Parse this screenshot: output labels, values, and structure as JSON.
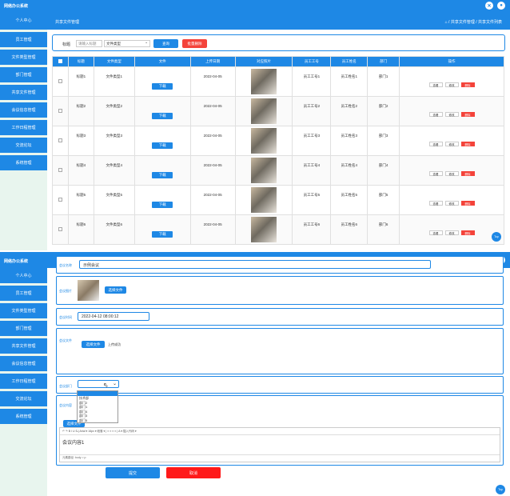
{
  "app_title": "网络办公系统",
  "sidebar_top": [
    "个人中心",
    "员工管理",
    "文件类型管理",
    "部门管理",
    "共享文件管理",
    "会议信息管理",
    "工作日程管理",
    "交流论坛",
    "系统管理"
  ],
  "sidebar_bottom": [
    "个人中心",
    "员工管理",
    "文件类型管理",
    "部门管理",
    "共享文件管理",
    "会议信息管理",
    "工作日程管理",
    "交流论坛",
    "系统管理"
  ],
  "page_header": {
    "title": "共享文件管理",
    "breadcrumb": "⌂ / 共享文件管理 / 共享文件列表"
  },
  "filter": {
    "label": "标题",
    "placeholder": "请输入标题",
    "select_value": "文件类型",
    "search_button": "查询",
    "batch_delete_button": "批量删除"
  },
  "table": {
    "headers": [
      "",
      "标题",
      "文件类型",
      "文件",
      "上传日期",
      "对应照片",
      "员工工号",
      "员工姓名",
      "部门",
      "操作"
    ],
    "download_label": "下载",
    "actions": {
      "view": "查看",
      "edit": "修改",
      "delete": "删除"
    },
    "rows": [
      {
        "title": "标题1",
        "type": "文件类型1",
        "date": "2022-04-05",
        "emp_no": "员工工号1",
        "emp_name": "员工姓名1",
        "dept": "部门1"
      },
      {
        "title": "标题2",
        "type": "文件类型2",
        "date": "2022-04-05",
        "emp_no": "员工工号2",
        "emp_name": "员工姓名2",
        "dept": "部门2"
      },
      {
        "title": "标题3",
        "type": "文件类型3",
        "date": "2022-04-05",
        "emp_no": "员工工号3",
        "emp_name": "员工姓名3",
        "dept": "部门3"
      },
      {
        "title": "标题4",
        "type": "文件类型4",
        "date": "2022-04-05",
        "emp_no": "员工工号4",
        "emp_name": "员工姓名4",
        "dept": "部门4"
      },
      {
        "title": "标题5",
        "type": "文件类型5",
        "date": "2022-04-05",
        "emp_no": "员工工号5",
        "emp_name": "员工姓名5",
        "dept": "部门5"
      },
      {
        "title": "标题6",
        "type": "文件类型6",
        "date": "2022-04-05",
        "emp_no": "员工工号6",
        "emp_name": "员工姓名6",
        "dept": "部门6"
      }
    ]
  },
  "top_button": "Top",
  "form": {
    "name_label": "会议名称",
    "name_value": "示例会议",
    "photo_label": "会议图片",
    "photo_button": "选择文件",
    "time_label": "会议时间",
    "time_value": "2022-04-12 08:00:12",
    "file_label": "会议文件",
    "file_button": "选择文件",
    "file_status": "上传成功",
    "dept_label": "会议部门",
    "dept_options": [
      "",
      "技术部",
      "部门2",
      "部门1",
      "部门4",
      "部门3",
      "部门5"
    ],
    "content_label": "会议内容",
    "content_upload_button": "选择文件",
    "editor_toolbar": "↶ ↷ B I U S̶ | Arial ▾ 16px ▾ 段落 ▾ | ≡ ≡ ≡ ≡ | A ▾ 插入代码 ▾",
    "editor_text": "会议内容1",
    "editor_footer": "元素路径: body > p",
    "submit_button": "提交",
    "cancel_button": "取消"
  },
  "colors": {
    "primary": "#1e88e5",
    "danger": "#f4433a",
    "sidebar_bg": "#e8f5ee"
  }
}
